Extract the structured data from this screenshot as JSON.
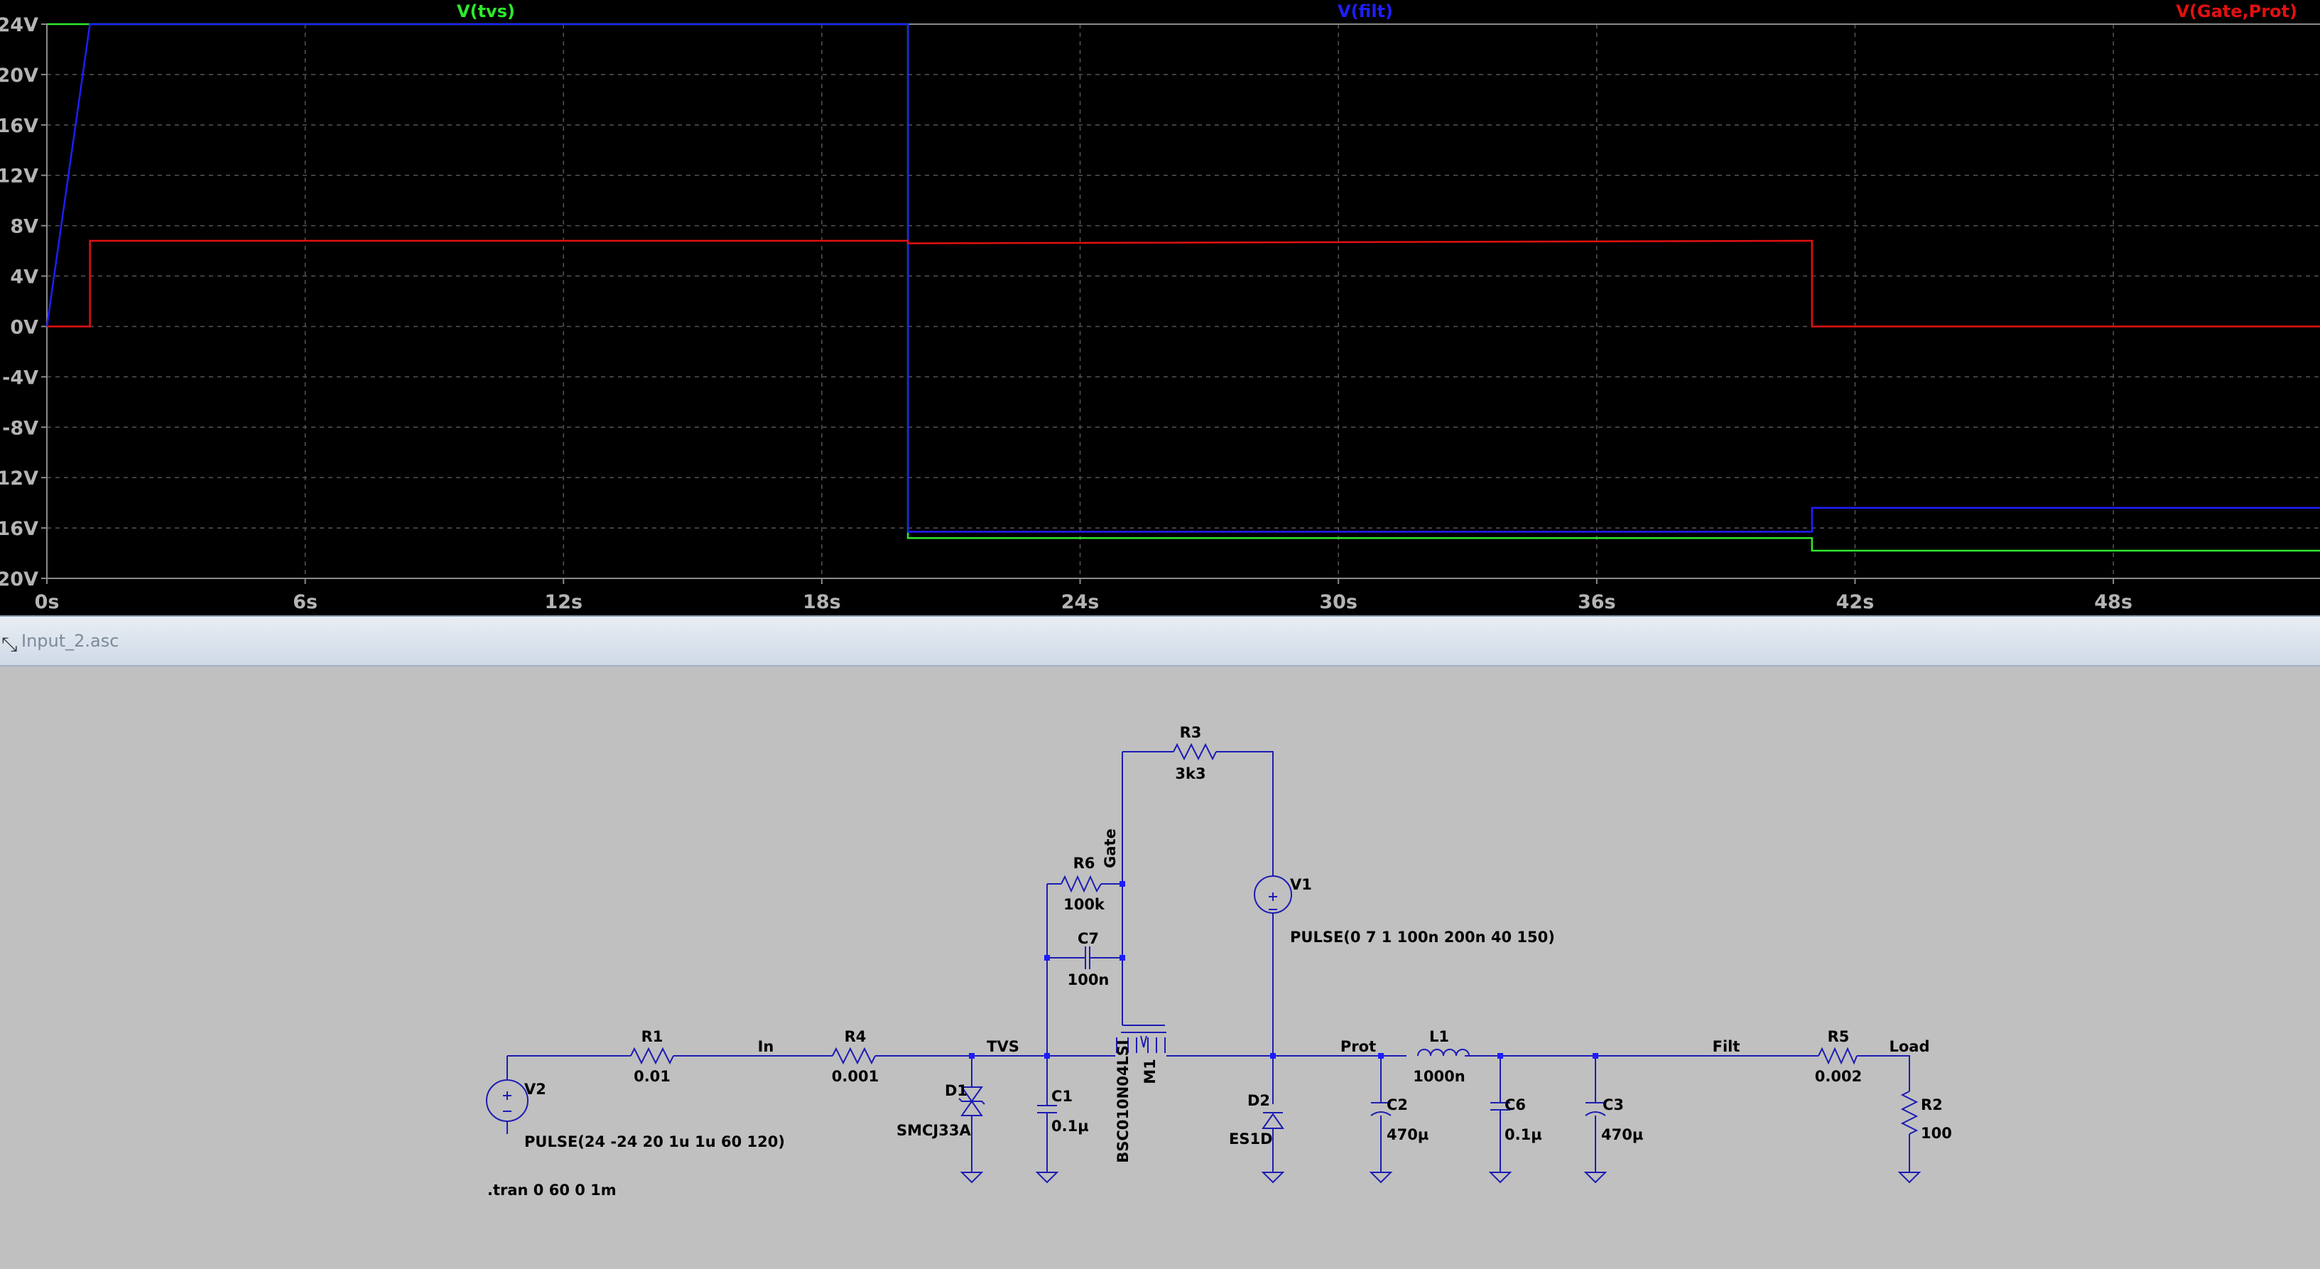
{
  "window": {
    "schematic_title": "Input_2.asc"
  },
  "chart_data": {
    "type": "line",
    "xlim": [
      0,
      52.8
    ],
    "ylim": [
      -20,
      24
    ],
    "x_ticks": [
      "0s",
      "6s",
      "12s",
      "18s",
      "24s",
      "30s",
      "36s",
      "42s",
      "48s"
    ],
    "y_ticks": [
      "24V",
      "20V",
      "16V",
      "12V",
      "8V",
      "4V",
      "0V",
      "-4V",
      "-8V",
      "-12V",
      "-16V",
      "-20V"
    ],
    "grid": true,
    "legend_placement": "top",
    "series": [
      {
        "name": "V(tvs)",
        "color": "#2ee82e",
        "x": [
          0,
          1,
          20,
          20,
          41,
          41,
          52.8
        ],
        "y": [
          24,
          24,
          24,
          -16.8,
          -16.8,
          -17.8,
          -17.8
        ]
      },
      {
        "name": "V(filt)",
        "color": "#1e1eff",
        "x": [
          0,
          1,
          20,
          20,
          41,
          41,
          52.8
        ],
        "y": [
          0,
          24,
          24,
          -16.3,
          -16.3,
          -14.4,
          -14.4
        ]
      },
      {
        "name": "V(Gate,Prot)",
        "color": "#e31010",
        "x": [
          0,
          1,
          1,
          20,
          20,
          41,
          41,
          52.8
        ],
        "y": [
          0,
          0,
          6.8,
          6.8,
          6.6,
          6.8,
          0,
          0
        ]
      }
    ]
  },
  "schematic": {
    "components": {
      "r1": {
        "ref": "R1",
        "value": "0.01"
      },
      "r4": {
        "ref": "R4",
        "value": "0.001"
      },
      "r3": {
        "ref": "R3",
        "value": "3k3"
      },
      "r6": {
        "ref": "R6",
        "value": "100k"
      },
      "c7": {
        "ref": "C7",
        "value": "100n"
      },
      "d1": {
        "ref": "D1",
        "value": "SMCJ33A"
      },
      "c1": {
        "ref": "C1",
        "value": "0.1µ"
      },
      "m1": {
        "ref": "M1",
        "value": "BSC010N04LSI"
      },
      "v1": {
        "ref": "V1",
        "value": "PULSE(0 7 1 100n 200n 40 150)"
      },
      "d2": {
        "ref": "D2",
        "value": "ES1D"
      },
      "c2": {
        "ref": "C2",
        "value": "470µ"
      },
      "l1": {
        "ref": "L1",
        "value": "1000n"
      },
      "c6": {
        "ref": "C6",
        "value": "0.1µ"
      },
      "c3": {
        "ref": "C3",
        "value": "470µ"
      },
      "r5": {
        "ref": "R5",
        "value": "0.002"
      },
      "r2": {
        "ref": "R2",
        "value": "100"
      },
      "v2": {
        "ref": "V2",
        "value": "PULSE(24 -24 20 1u 1u 60 120)"
      }
    },
    "nets": {
      "in": "In",
      "tvs": "TVS",
      "gate": "Gate",
      "prot": "Prot",
      "filt": "Filt",
      "load": "Load"
    },
    "directive": ".tran 0 60 0 1m"
  }
}
